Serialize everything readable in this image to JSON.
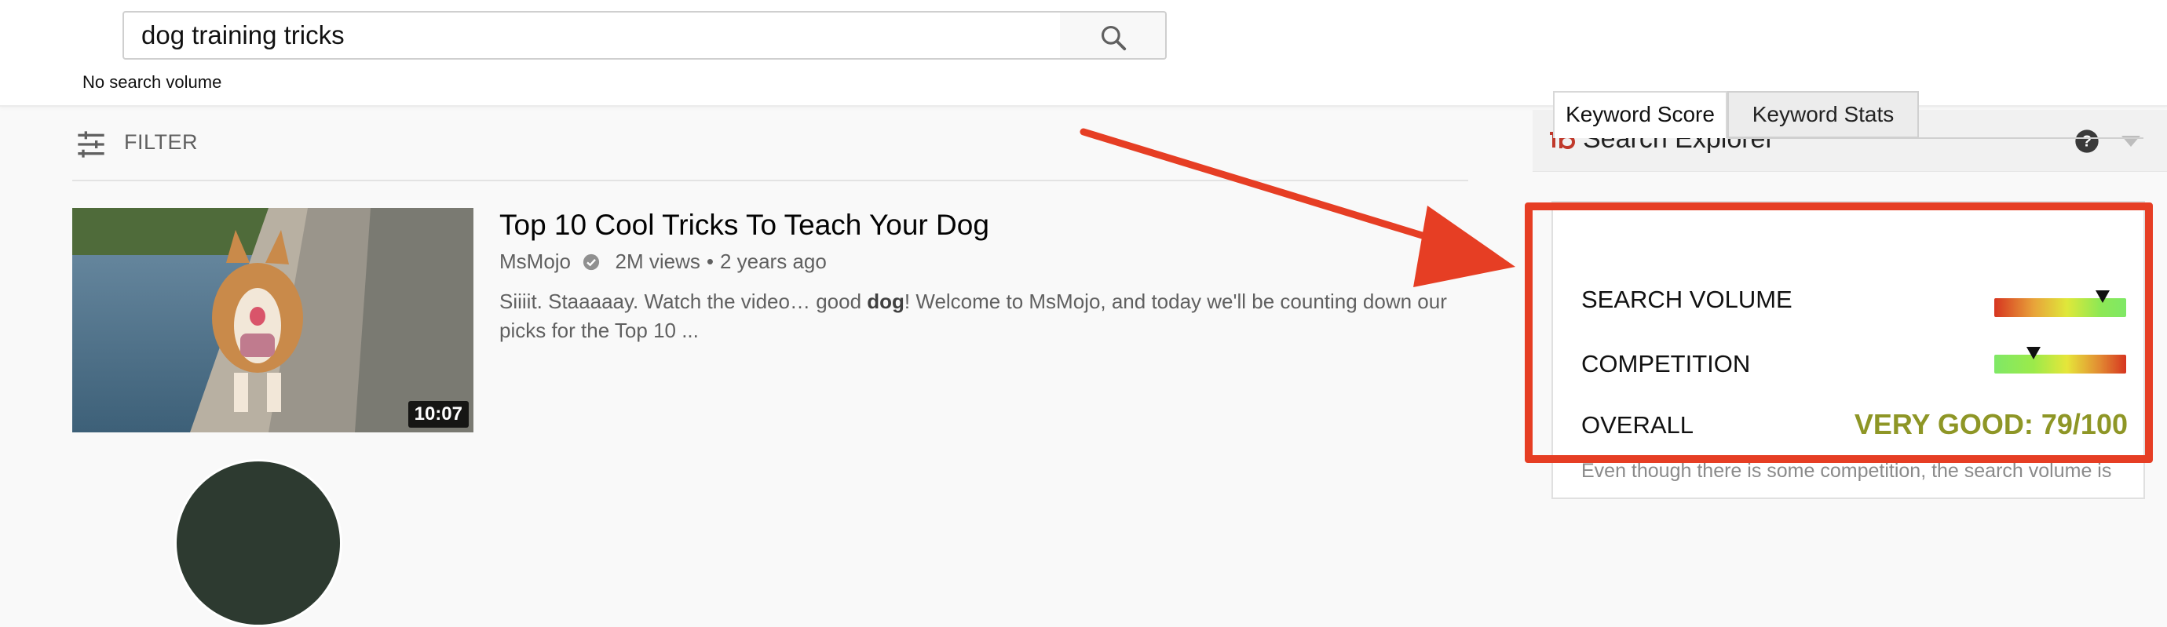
{
  "search": {
    "query": "dog training tricks",
    "volume_note": "No search volume"
  },
  "filter": {
    "label": "FILTER"
  },
  "result": {
    "title": "Top 10 Cool Tricks To Teach Your Dog",
    "channel": "MsMojo",
    "views": "2M views",
    "separator": "•",
    "age": "2 years ago",
    "duration": "10:07",
    "desc_before": "Siiiit. Staaaaay. Watch the video… good ",
    "desc_bold": "dog",
    "desc_after": "! Welcome to MsMojo, and today we'll be counting down our picks for the Top 10 ..."
  },
  "panel": {
    "title": "Search Explorer",
    "tabs": [
      {
        "label": "Keyword Score",
        "active": true
      },
      {
        "label": "Keyword Stats",
        "active": false
      }
    ],
    "rows": [
      {
        "label": "SEARCH VOLUME",
        "meter_level": 0.82
      },
      {
        "label": "COMPETITION",
        "meter_level": 0.3
      },
      {
        "label": "OVERALL",
        "value": "VERY GOOD: 79/100"
      }
    ],
    "footnote": "Even though there is some competition, the search volume is"
  },
  "colors": {
    "callout": "#e63e24",
    "overall_value": "#8e9626",
    "tubebuddy_logo": "#c0392b"
  },
  "icons": [
    "search-icon",
    "filter-icon",
    "verified-icon",
    "tubebuddy-logo-icon",
    "help-icon",
    "caret-down-icon"
  ]
}
